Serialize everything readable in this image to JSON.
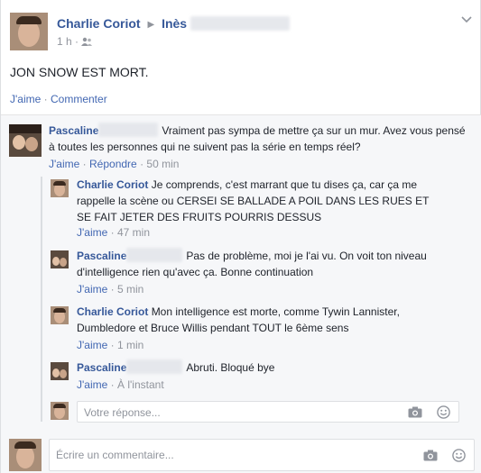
{
  "post": {
    "author": "Charlie Coriot",
    "target": "Inès",
    "time": "1 h",
    "text": "JON SNOW EST MORT.",
    "actions": {
      "like": "J'aime",
      "comment": "Commenter"
    }
  },
  "comments": [
    {
      "author": "Pascaline",
      "text": "Vraiment pas sympa de mettre ça sur un mur. Avez vous pensé à toutes les personnes qui ne suivent pas la série en temps réel?",
      "like": "J'aime",
      "reply": "Répondre",
      "time": "50 min"
    }
  ],
  "replies": [
    {
      "author": "Charlie Coriot",
      "text": "Je comprends, c'est marrant que tu dises ça, car ça me rappelle la scène ou CERSEI SE BALLADE A POIL DANS LES RUES ET SE FAIT JETER DES FRUITS POURRIS DESSUS",
      "like": "J'aime",
      "time": "47 min"
    },
    {
      "author": "Pascaline",
      "text": "Pas de problème, moi je l'ai vu. On voit ton niveau d'intelligence rien qu'avec ça. Bonne continuation",
      "like": "J'aime",
      "time": "5 min"
    },
    {
      "author": "Charlie Coriot",
      "text": "Mon intelligence est morte, comme Tywin Lannister, Dumbledore et Bruce Willis pendant TOUT le 6ème sens",
      "like": "J'aime",
      "time": "1 min"
    },
    {
      "author": "Pascaline",
      "text": "Abruti. Bloqué bye",
      "like": "J'aime",
      "time": "À l'instant"
    }
  ],
  "reply_input": {
    "placeholder": "Votre réponse..."
  },
  "comment_input": {
    "placeholder": "Écrire un commentaire..."
  }
}
